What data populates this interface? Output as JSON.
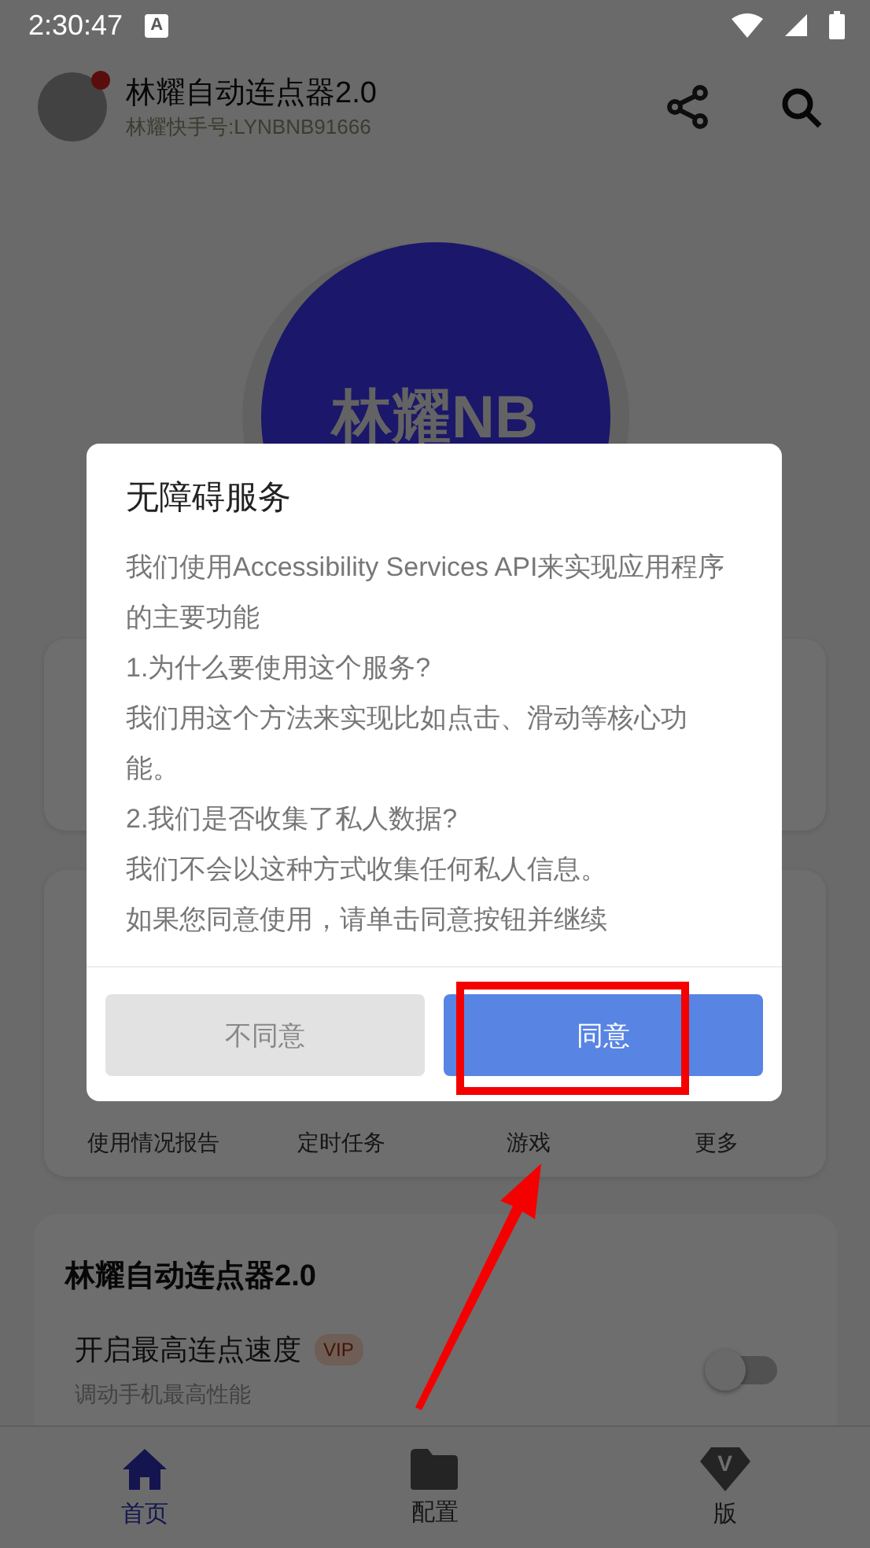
{
  "status_bar": {
    "time": "2:30:47",
    "notification_glyph": "A"
  },
  "app_bar": {
    "title": "林耀自动连点器2.0",
    "subtitle": "林耀快手号:LYNBNB91666"
  },
  "hero": {
    "label": "林耀NB"
  },
  "shortcuts": [
    "使用情况报告",
    "定时任务",
    "游戏",
    "更多"
  ],
  "settings_card": {
    "title": "林耀自动连点器2.0",
    "rows": [
      {
        "label": "开启最高连点速度",
        "badge": "VIP",
        "description": "调动手机最高性能",
        "on": false
      }
    ]
  },
  "bottom_nav": [
    {
      "label": "首页",
      "selected": true
    },
    {
      "label": "配置",
      "selected": false
    },
    {
      "label": "版",
      "icon_letter": "V",
      "selected": false
    }
  ],
  "dialog": {
    "title": "无障碍服务",
    "paragraphs": [
      "我们使用Accessibility Services API来实现应用程序的主要功能",
      "1.为什么要使用这个服务?",
      "我们用这个方法来实现比如点击、滑动等核心功能。",
      "2.我们是否收集了私人数据?",
      "我们不会以这种方式收集任何私人信息。",
      "如果您同意使用，请单击同意按钮并继续"
    ],
    "buttons": [
      {
        "label": "不同意",
        "kind": "secondary",
        "highlighted": false
      },
      {
        "label": "同意",
        "kind": "primary",
        "highlighted": true
      }
    ]
  }
}
